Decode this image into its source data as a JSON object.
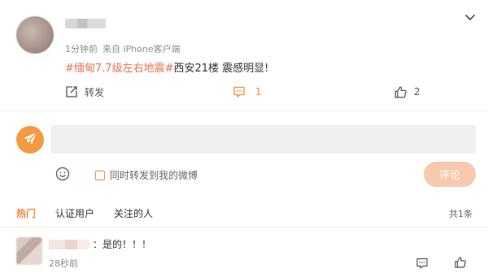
{
  "post": {
    "time": "1分钟前",
    "source": "来自 iPhone客户端",
    "topic": "#缅甸7.7级左右地震#",
    "text": "西安21楼 震感明显!"
  },
  "actions": {
    "forward_label": "转发",
    "comment_count": "1",
    "like_count": "2"
  },
  "composer": {
    "placeholder": "",
    "repost_label": "同时转发到我的微博",
    "submit_label": "评论"
  },
  "tabs": [
    "热门",
    "认证用户",
    "关注的人"
  ],
  "comments_total": "共1条",
  "comments": [
    {
      "text": "：是的！！！",
      "time": "28秒前"
    }
  ],
  "colors": {
    "accent": "#f08a39",
    "topic": "#eb7350",
    "submit_bg": "#f7c9ad"
  }
}
